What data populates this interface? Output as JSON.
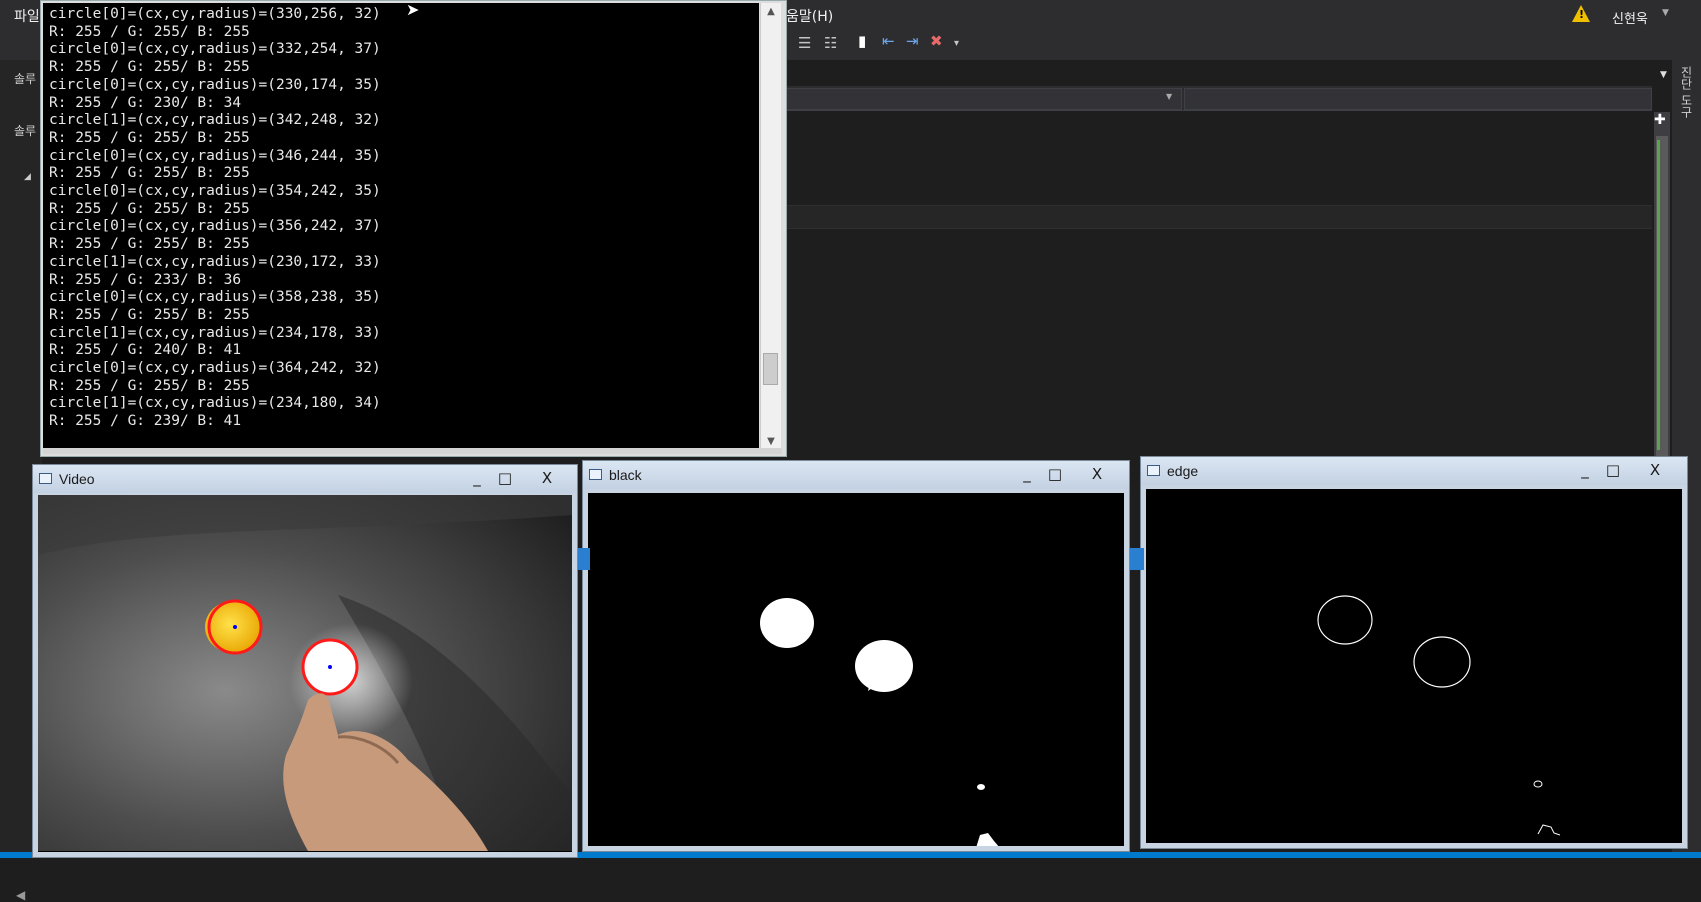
{
  "vs": {
    "menu_file": "파일",
    "menu_help": "움말(H)",
    "user_name": "신현욱",
    "left_label_1": "솔루",
    "left_label_2": "솔루",
    "vertical_tab": "진단 도구",
    "warning_icon": "warning-icon"
  },
  "console": {
    "lines": [
      "circle[0]=(cx,cy,radius)=(330,256, 32)",
      "R: 255 / G: 255/ B: 255",
      "circle[0]=(cx,cy,radius)=(332,254, 37)",
      "R: 255 / G: 255/ B: 255",
      "circle[0]=(cx,cy,radius)=(230,174, 35)",
      "R: 255 / G: 230/ B: 34",
      "circle[1]=(cx,cy,radius)=(342,248, 32)",
      "R: 255 / G: 255/ B: 255",
      "circle[0]=(cx,cy,radius)=(346,244, 35)",
      "R: 255 / G: 255/ B: 255",
      "circle[0]=(cx,cy,radius)=(354,242, 35)",
      "R: 255 / G: 255/ B: 255",
      "circle[0]=(cx,cy,radius)=(356,242, 37)",
      "R: 255 / G: 255/ B: 255",
      "circle[1]=(cx,cy,radius)=(230,172, 33)",
      "R: 255 / G: 233/ B: 36",
      "circle[0]=(cx,cy,radius)=(358,238, 35)",
      "R: 255 / G: 255/ B: 255",
      "circle[1]=(cx,cy,radius)=(234,178, 33)",
      "R: 255 / G: 240/ B: 41",
      "circle[0]=(cx,cy,radius)=(364,242, 32)",
      "R: 255 / G: 255/ B: 255",
      "circle[1]=(cx,cy,radius)=(234,180, 34)",
      "R: 255 / G: 239/ B: 41"
    ]
  },
  "windows": {
    "video": {
      "title": "Video"
    },
    "black": {
      "title": "black"
    },
    "edge": {
      "title": "edge"
    }
  },
  "window_buttons": {
    "minimize": "_",
    "maximize": "□",
    "close": "X"
  },
  "colors": {
    "vs_bg": "#1e1e1e",
    "vs_accent": "#007acc",
    "detection_ring": "#ff1a1a",
    "center_dot": "#0000ff"
  }
}
